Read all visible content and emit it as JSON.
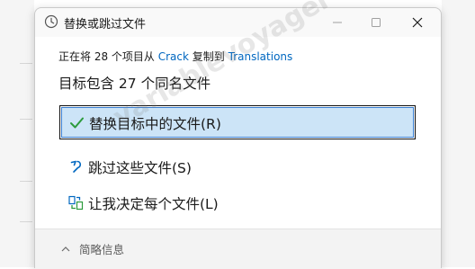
{
  "window": {
    "title": "替换或跳过文件"
  },
  "copy_status": {
    "prefix": "正在将 28 个项目从",
    "source": "Crack",
    "middle": "复制到",
    "destination": "Translations"
  },
  "conflict_message": "目标包含 27 个同名文件",
  "options": {
    "replace": "替换目标中的文件(R)",
    "skip": "跳过这些文件(S)",
    "decide": "让我决定每个文件(L)"
  },
  "footer": {
    "less_info": "简略信息"
  },
  "watermark": "variablevoyager",
  "colors": {
    "accent_link": "#0067c0",
    "selected_bg": "#cce4f7",
    "check_green": "#2c9b3c"
  },
  "icons": {
    "title": "clock-icon",
    "replace": "checkmark-icon",
    "skip": "undo-arrow-icon",
    "decide": "compare-files-icon",
    "less_info": "chevron-up-icon"
  }
}
